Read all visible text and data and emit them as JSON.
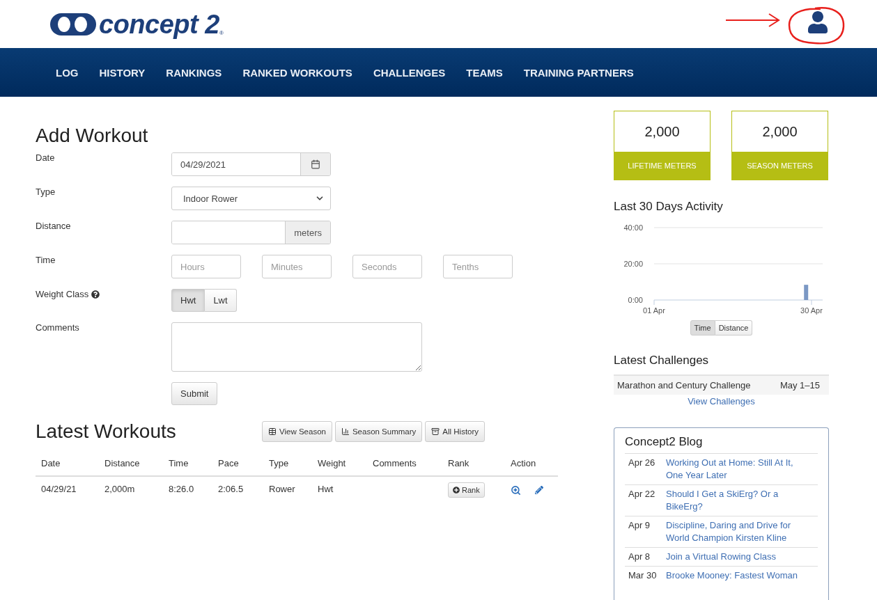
{
  "logo": {
    "wordmark": "concept 2",
    "registered": "®"
  },
  "nav": [
    {
      "label": "LOG"
    },
    {
      "label": "HISTORY"
    },
    {
      "label": "RANKINGS"
    },
    {
      "label": "RANKED WORKOUTS"
    },
    {
      "label": "CHALLENGES"
    },
    {
      "label": "TEAMS"
    },
    {
      "label": "TRAINING PARTNERS"
    }
  ],
  "add_workout": {
    "title": "Add Workout",
    "fields": [
      {
        "kind": "date",
        "label": "Date",
        "value": "04/29/2021"
      },
      {
        "kind": "select",
        "label": "Type",
        "value": "Indoor Rower"
      },
      {
        "kind": "addon",
        "label": "Distance",
        "addon": "meters"
      },
      {
        "kind": "time",
        "label": "Time",
        "placeholders": [
          "Hours",
          "Minutes",
          "Seconds",
          "Tenths"
        ]
      },
      {
        "kind": "toggle",
        "label": "Weight Class",
        "help": true,
        "options": [
          {
            "label": "Hwt",
            "selected": true
          },
          {
            "label": "Lwt",
            "selected": false
          }
        ]
      },
      {
        "kind": "textarea",
        "label": "Comments"
      }
    ],
    "submit": "Submit"
  },
  "latest_workouts": {
    "title": "Latest Workouts",
    "buttons": [
      "View Season",
      "Season Summary",
      "All History"
    ],
    "columns": [
      "Date",
      "Distance",
      "Time",
      "Pace",
      "Type",
      "Weight",
      "Comments",
      "Rank",
      "Action"
    ],
    "rows": [
      {
        "cells": [
          "04/29/21",
          "2,000m",
          "8:26.0",
          "2:06.5",
          "Rower",
          "Hwt"
        ],
        "rank": "Rank"
      }
    ]
  },
  "stats": [
    {
      "value": "2,000",
      "label": "LIFETIME METERS"
    },
    {
      "value": "2,000",
      "label": "SEASON METERS"
    }
  ],
  "activity": {
    "title": "Last 30 Days Activity",
    "chart_data": {
      "type": "bar",
      "categories": [
        "01 Apr",
        null,
        null,
        null,
        null,
        null,
        null,
        null,
        null,
        null,
        null,
        null,
        null,
        null,
        null,
        null,
        null,
        null,
        null,
        null,
        null,
        null,
        null,
        null,
        null,
        null,
        null,
        null,
        null,
        "30 Apr"
      ],
      "values": [
        null,
        null,
        null,
        null,
        null,
        null,
        null,
        null,
        null,
        null,
        null,
        null,
        null,
        null,
        null,
        null,
        null,
        null,
        null,
        null,
        null,
        null,
        null,
        null,
        null,
        null,
        null,
        null,
        8.4,
        null
      ],
      "ylim": [
        0,
        40
      ],
      "yticks": [
        {
          "value": 0,
          "label": "0:00"
        },
        {
          "value": 20,
          "label": "20:00"
        },
        {
          "value": 40,
          "label": "40:00"
        }
      ]
    },
    "toggle": [
      {
        "label": "Time",
        "selected": true
      },
      {
        "label": "Distance",
        "selected": false
      }
    ]
  },
  "challenges": {
    "title": "Latest Challenges",
    "rows": [
      {
        "name": "Marathon and Century Challenge",
        "dates": "May 1–15"
      }
    ],
    "link": "View Challenges"
  },
  "blog": {
    "title": "Concept2 Blog",
    "posts": [
      {
        "date": "Apr 26",
        "title": "Working Out at Home: Still At It, One Year Later"
      },
      {
        "date": "Apr 22",
        "title": "Should I Get a SkiErg? Or a BikeErg?"
      },
      {
        "date": "Apr 9",
        "title": "Discipline, Daring and Drive for World Champion Kirsten Kline"
      },
      {
        "date": "Apr 8",
        "title": "Join a Virtual Rowing Class"
      },
      {
        "date": "Mar 30",
        "title": "Brooke Mooney: Fastest Woman"
      }
    ]
  }
}
